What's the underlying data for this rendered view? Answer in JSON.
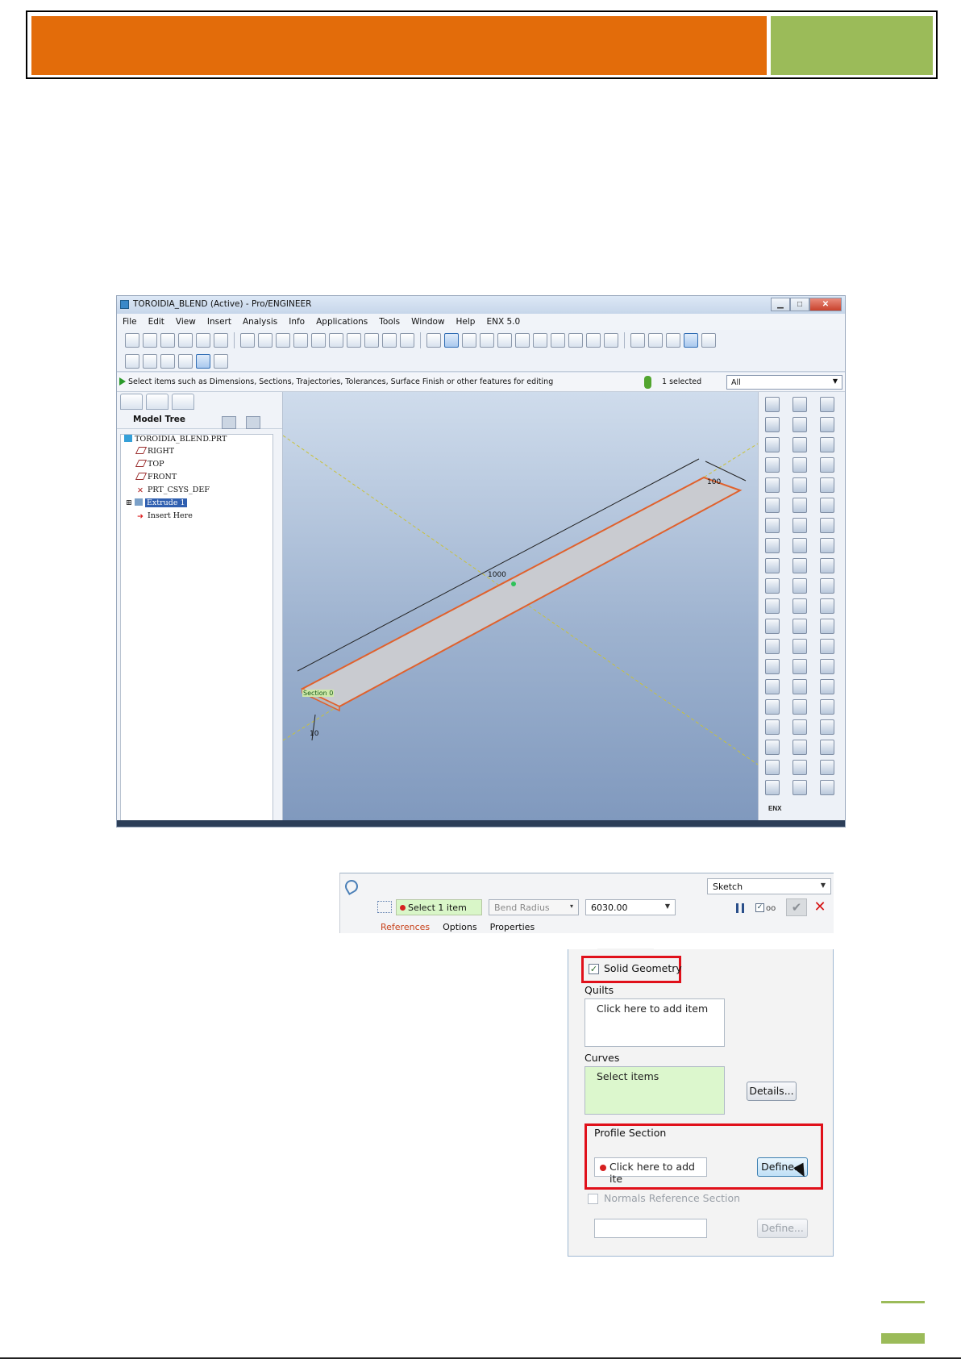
{
  "window": {
    "title": "TOROIDIA_BLEND (Active) - Pro/ENGINEER",
    "buttons": [
      "▁",
      "□",
      "✕"
    ]
  },
  "menu": [
    "File",
    "Edit",
    "View",
    "Insert",
    "Analysis",
    "Info",
    "Applications",
    "Tools",
    "Window",
    "Help",
    "ENX 5.0"
  ],
  "status": {
    "message": "Select items such as Dimensions, Sections, Trajectories, Tolerances, Surface Finish or other features for editing",
    "selected": "1 selected",
    "filter": "All"
  },
  "model_tree": {
    "title": "Model Tree",
    "items": [
      {
        "label": "TOROIDIA_BLEND.PRT",
        "icon": "part-icon"
      },
      {
        "label": "RIGHT",
        "icon": "datum-plane-icon"
      },
      {
        "label": "TOP",
        "icon": "datum-plane-icon"
      },
      {
        "label": "FRONT",
        "icon": "datum-plane-icon"
      },
      {
        "label": "PRT_CSYS_DEF",
        "icon": "csys-icon"
      },
      {
        "label": "Extrude 1",
        "icon": "extrude-icon"
      },
      {
        "label": "Insert Here",
        "icon": "insert-arrow-icon"
      }
    ]
  },
  "graphics": {
    "dimensions": {
      "length": "1000",
      "width": "100",
      "thickness": "10"
    },
    "section_label": "Section 0"
  },
  "right_toolbar": {
    "enx_label": "ENX"
  },
  "dashboard": {
    "select_item": "Select 1 item",
    "bend_radius": "Bend Radius",
    "radius_value": "6030.00",
    "mode": "Sketch",
    "ok_glyph": "✔",
    "cancel_glyph": "✕",
    "tabs": [
      "References",
      "Options",
      "Properties"
    ]
  },
  "references_panel": {
    "solid_geometry": "Solid Geometry",
    "quilts_label": "Quilts",
    "quilts_collector": "Click here to add item",
    "curves_label": "Curves",
    "curves_collector": "Select items",
    "details_button": "Details...",
    "profile_section_label": "Profile Section",
    "profile_collector": "Click here to add ite",
    "define_button": "Define...",
    "normals_label": "Normals Reference Section",
    "normals_define_button": "Define..."
  },
  "colors": {
    "banner_orange": "#e36c0a",
    "banner_green": "#9bbb59",
    "highlight_red": "#e0101a"
  }
}
